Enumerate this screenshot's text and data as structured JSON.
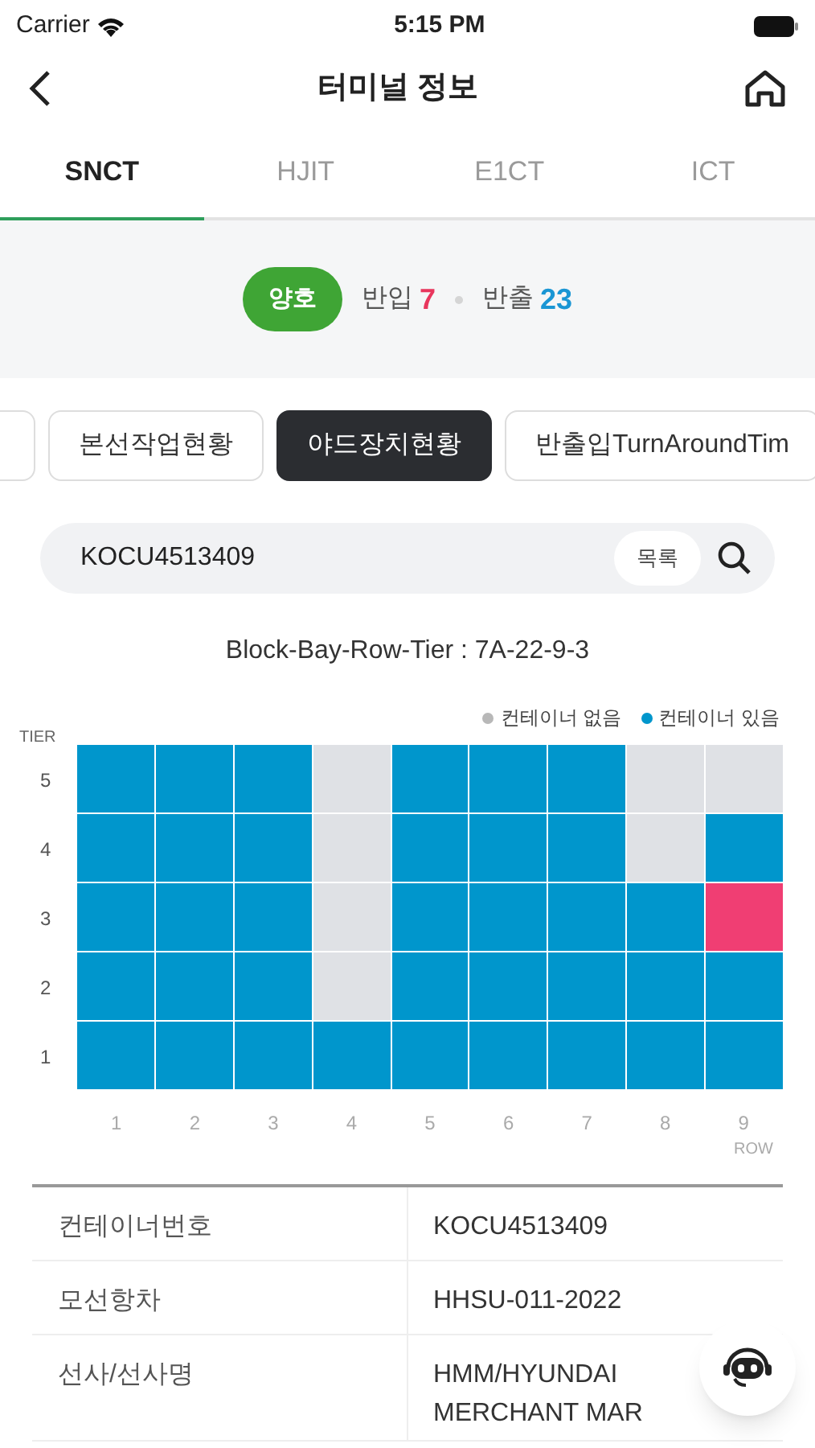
{
  "status_bar": {
    "carrier": "Carrier",
    "time": "5:15 PM"
  },
  "header": {
    "title": "터미널 정보"
  },
  "tabs": [
    {
      "label": "SNCT",
      "selected": true
    },
    {
      "label": "HJIT",
      "selected": false
    },
    {
      "label": "E1CT",
      "selected": false
    },
    {
      "label": "ICT",
      "selected": false
    }
  ],
  "summary": {
    "status": {
      "label": "양호",
      "kind": "good"
    },
    "counts": [
      {
        "label": "반입",
        "value": "7",
        "color": "#e8365d"
      },
      {
        "label": "반출",
        "value": "23",
        "color": "#1a96d4"
      }
    ]
  },
  "chips": [
    {
      "label": "본선작업현황",
      "selected": false
    },
    {
      "label": "야드장치현황",
      "selected": true
    },
    {
      "label": "반출입TurnAroundTim",
      "selected": false
    }
  ],
  "search": {
    "value": "KOCU4513409",
    "list_button": "목록"
  },
  "yard": {
    "title": "Block-Bay-Row-Tier : 7A-22-9-3",
    "legend": [
      {
        "label": "컨테이너 없음",
        "color": "#b8b8b8"
      },
      {
        "label": "컨테이너 있음",
        "color": "#0096cc"
      }
    ],
    "y_axis_label": "TIER",
    "tiers": [
      "5",
      "4",
      "3",
      "2",
      "1"
    ],
    "x_axis_label": "ROW",
    "rows": [
      {
        "label": "1",
        "cells": [
          {
            "occupied": true,
            "selected": false
          },
          {
            "occupied": true,
            "selected": false
          },
          {
            "occupied": true,
            "selected": false
          },
          {
            "occupied": true,
            "selected": false
          },
          {
            "occupied": true,
            "selected": false
          }
        ]
      },
      {
        "label": "2",
        "cells": [
          {
            "occupied": true,
            "selected": false
          },
          {
            "occupied": true,
            "selected": false
          },
          {
            "occupied": true,
            "selected": false
          },
          {
            "occupied": true,
            "selected": false
          },
          {
            "occupied": true,
            "selected": false
          }
        ]
      },
      {
        "label": "3",
        "cells": [
          {
            "occupied": true,
            "selected": false
          },
          {
            "occupied": true,
            "selected": false
          },
          {
            "occupied": true,
            "selected": false
          },
          {
            "occupied": true,
            "selected": false
          },
          {
            "occupied": true,
            "selected": false
          }
        ]
      },
      {
        "label": "4",
        "cells": [
          {
            "occupied": false,
            "selected": false
          },
          {
            "occupied": false,
            "selected": false
          },
          {
            "occupied": false,
            "selected": false
          },
          {
            "occupied": false,
            "selected": false
          },
          {
            "occupied": true,
            "selected": false
          }
        ]
      },
      {
        "label": "5",
        "cells": [
          {
            "occupied": true,
            "selected": false
          },
          {
            "occupied": true,
            "selected": false
          },
          {
            "occupied": true,
            "selected": false
          },
          {
            "occupied": true,
            "selected": false
          },
          {
            "occupied": true,
            "selected": false
          }
        ]
      },
      {
        "label": "6",
        "cells": [
          {
            "occupied": true,
            "selected": false
          },
          {
            "occupied": true,
            "selected": false
          },
          {
            "occupied": true,
            "selected": false
          },
          {
            "occupied": true,
            "selected": false
          },
          {
            "occupied": true,
            "selected": false
          }
        ]
      },
      {
        "label": "7",
        "cells": [
          {
            "occupied": true,
            "selected": false
          },
          {
            "occupied": true,
            "selected": false
          },
          {
            "occupied": true,
            "selected": false
          },
          {
            "occupied": true,
            "selected": false
          },
          {
            "occupied": true,
            "selected": false
          }
        ]
      },
      {
        "label": "8",
        "cells": [
          {
            "occupied": false,
            "selected": false
          },
          {
            "occupied": false,
            "selected": false
          },
          {
            "occupied": true,
            "selected": false
          },
          {
            "occupied": true,
            "selected": false
          },
          {
            "occupied": true,
            "selected": false
          }
        ]
      },
      {
        "label": "9",
        "cells": [
          {
            "occupied": false,
            "selected": false
          },
          {
            "occupied": true,
            "selected": false
          },
          {
            "occupied": true,
            "selected": true
          },
          {
            "occupied": true,
            "selected": false
          },
          {
            "occupied": true,
            "selected": false
          }
        ]
      }
    ]
  },
  "details": [
    {
      "label": "컨테이너번호",
      "value": "KOCU4513409"
    },
    {
      "label": "모선항차",
      "value": "HHSU-011-2022"
    },
    {
      "label": "선사/선사명",
      "value": "HMM/HYUNDAI MERCHANT MAR"
    }
  ]
}
